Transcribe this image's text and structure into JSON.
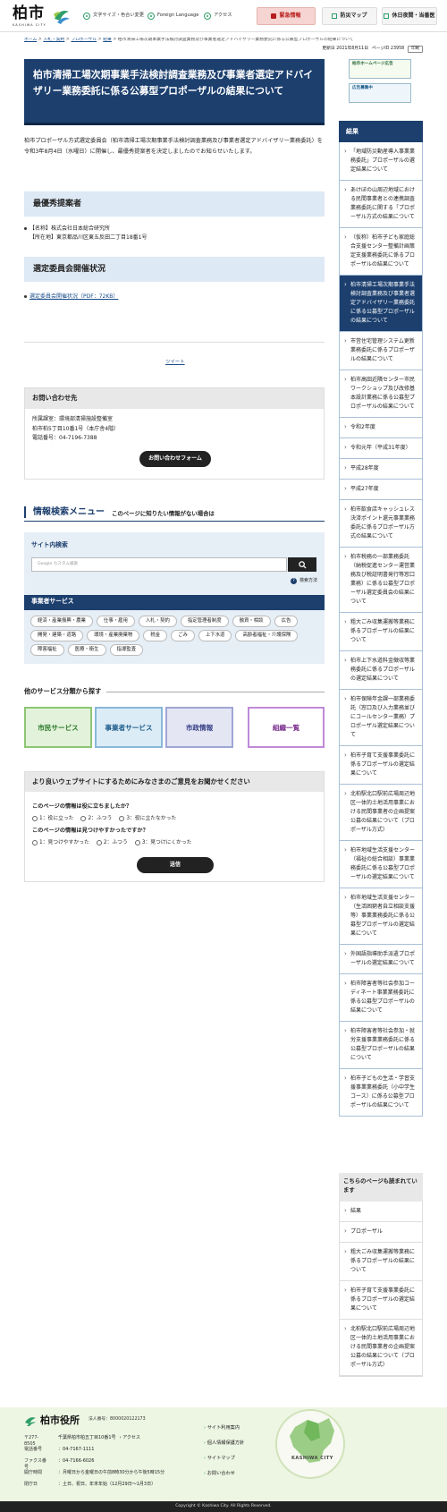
{
  "header": {
    "logo_kanji": "柏市",
    "logo_en": "KASHIWA CITY",
    "util_font": "文字サイズ・色合い変更",
    "util_lang": "Foreign Language",
    "util_access": "アクセス",
    "btn_emergency": "緊急情報",
    "btn_prevention": "防災マップ",
    "btn_night": "休日夜間・当番医"
  },
  "breadcrumb": {
    "items": [
      "ホーム",
      "入札・契約",
      "プロポーザル",
      "結果"
    ],
    "current": "柏市清掃工場次期事業手法検討調査業務及び事業者選定アドバイザリー業務委託に係る公募型プロポーザルの結果について",
    "sep": ">"
  },
  "meta": {
    "updated": "更新日 2021年8月11日",
    "page_id": "ページID 23958",
    "print": "印刷"
  },
  "page": {
    "title": "柏市清掃工場次期事業手法検討調査業務及び事業者選定アドバイザリー業務委託に係る公募型プロポーザルの結果について",
    "intro": "柏市プロポーザル方式選定委員会（柏市清掃工場次期事業手法検討調査業務及び事業者選定アドバイザリー業務委託）を令和3年8月4日（水曜日）に開催し、最優秀提案者を決定しましたのでお知らせいたします。",
    "sec1_title": "最優秀提案者",
    "sec1_name": "【名称】株式会社日本総合研究所",
    "sec1_addr": "【所在地】東京都品川区東五反田二丁目18番1号",
    "sec2_title": "選定委員会開催状況",
    "sec2_link": "選定委員会開催状況（PDF：72KB）",
    "tweet": "ツイート"
  },
  "contact": {
    "title": "お問い合わせ先",
    "dept": "所属課室：環境部清掃施設整備室",
    "addr": "柏市柏5丁目10番1号（本庁舎4階）",
    "tel": "電話番号：04-7196-7388",
    "form_btn": "お問い合わせフォーム"
  },
  "search": {
    "title": "情報検索メニュー",
    "subtitle": "このページに知りたい情報がない場合は",
    "site_label": "サイト内検索",
    "placeholder": "Google カスタム検索",
    "how": "検索方法",
    "biz_title": "事業者サービス",
    "tags": [
      "経済・産業振興・農業",
      "仕事・雇用",
      "入札・契約",
      "指定管理者制度",
      "融資・相談",
      "広告",
      "開発・建築・道路",
      "環境・産業廃棄物",
      "税金",
      "ごみ",
      "上下水道",
      "高齢者福祉・介護保険",
      "障害福祉",
      "医療・衛生",
      "指導監査"
    ]
  },
  "other": {
    "title": "他のサービス分類から探す",
    "svc1": "市民サービス",
    "svc2": "事業者サービス",
    "svc3": "市政情報",
    "svc4": "組織一覧"
  },
  "feedback": {
    "title": "より良いウェブサイトにするためにみなさまのご意見をお聞かせください",
    "q1": "このページの情報は役に立ちましたか？",
    "q1_opts": [
      "1：役に立った",
      "2：ふつう",
      "3：役に立たなかった"
    ],
    "q2": "このページの情報は見つけやすかったですか？",
    "q2_opts": [
      "1：見つけやすかった",
      "2：ふつう",
      "3：見つけにくかった"
    ],
    "submit": "送信"
  },
  "sidebar": {
    "banner1": "柏市ホームページ広告",
    "banner2": "広告募集中",
    "title": "結果",
    "items": [
      "「地域防災動産導入事業業務委託」プロポーザルの選定結果について",
      "あけぼの山周辺地域における民間事業者との連携調査業務委託に関する「プロポーザル方式の結果について",
      "（仮称）柏市子ども家庭総合支援センター整備計画策定支援業務委託に係るプロポーザルの結果について",
      "柏市清掃工場次期事業手法検討調査業務及び事業者選定アドバイザリー業務委託に係る公募型プロポーザルの結果について",
      "市営住宅管理システム更新業務委託に係るプロポーザルの結果について",
      "柏市高田近隣センター市民ワークショップ及び改修基本設計業務に係る公募型プロポーザルの結果について",
      "令和2年度",
      "令和元年（平成31年度）",
      "平成28年度",
      "平成27年度",
      "柏市飲食店キャッシュレス決済ポイント還元事業業務委託に係るプロポーザル方式の結果について",
      "柏市税務の一部業務委託（納税促進センター運営業務及び税証明書発行等窓口業務）に係る公募型プロポーザル選定委員会の結果について",
      "粗大ごみ収集運搬等業務に係るプロポーザルの結果について",
      "柏市上下水道料金徴収等業務委託に係るプロポーザルの選定結果について",
      "柏市保険年金課一部業務委託（窓口及び入力業務並びにコールセンター業務）プロポーザル選定結果について",
      "柏市子育て支援事業委託に係るプロポーザルの選定結果について",
      "北柏駅北口駅前広場周辺地区一体的土地活用事業における民間事業者の企画提案公募の結果について（プロポーザル方式）",
      "柏市地域生活支援センター（福祉の総合相談）事業業務委託に係る公募型プロポーザルの選定結果について",
      "柏市地域生活支援センター（生活困窮者自立相談支援等）事業業務委託に係る公募型プロポーザルの選定結果について",
      "外国語指導助手派遣プロポーザルの選定結果について",
      "柏市障害者等社会参加コーディネート事業業務委託に係る公募型プロポーザルの結果について",
      "柏市障害者等社会参加・就労支援事業業務委託に係る公募型プロポーザルの結果について",
      "柏市子どもの生活・学習支援事業業務委託（小中学生コース）に係る公募型プロポーザルの結果について"
    ],
    "also_title": "こちらのページも読まれています",
    "also_items": [
      "結果",
      "プロポーザル",
      "粗大ごみ収集運搬等業務に係るプロポーザルの結果について",
      "柏市子育て支援事業委託に係るプロポーザルの選定結果について",
      "北柏駅北口駅前広場周辺地区一体的土地活用事業における民間事業者の企画提案公募の結果について（プロポーザル方式）"
    ]
  },
  "footer": {
    "name": "柏市役所",
    "corp_no": "法人番号：8000020122173",
    "zip": "〒277-8505",
    "addr": "千葉県柏市柏五丁目10番1号",
    "access": "› アクセス",
    "tel_k": "電話番号",
    "tel": "：04-7167-1111",
    "fax_k": "ファクス番号",
    "fax": "：04-7166-6026",
    "open_k": "開庁時間",
    "open": "：月曜日から金曜日の午前8時30分から午後5時15分",
    "closed_k": "閉庁日",
    "closed": "：土日、祝日、年末年始（12月29日～1月3日）",
    "links": [
      "サイト利用案内",
      "個人情報保護方針",
      "サイトマップ",
      "お問い合わせ"
    ],
    "map_label": "KASHIWA CITY",
    "copyright": "Copyright © Kashiwa City. All Rights Reserved."
  },
  "colors": {
    "primary": "#1c3f6e",
    "accent_green": "#2f9e6a",
    "emergency": "#b81c1c",
    "light_blue": "#dde9f4"
  }
}
